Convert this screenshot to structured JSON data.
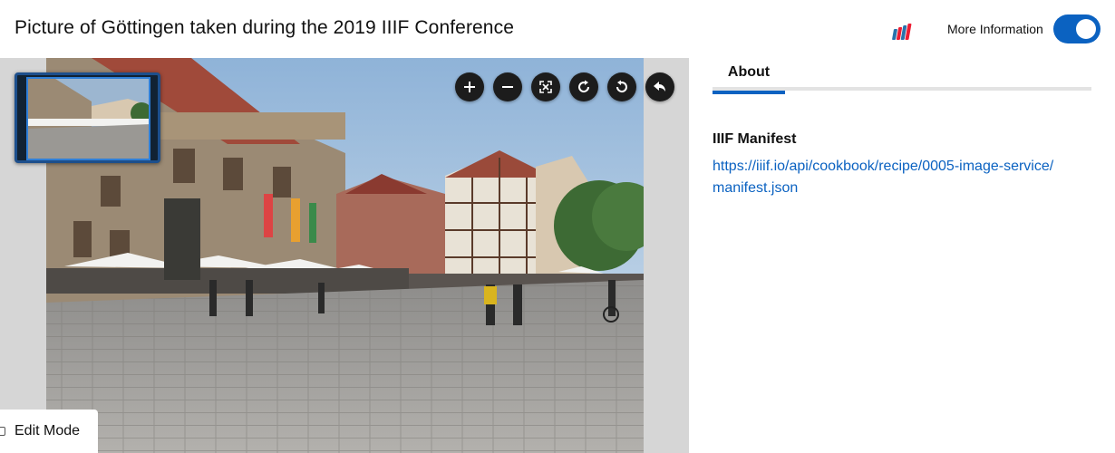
{
  "header": {
    "title": "Picture of Göttingen taken during the 2019 IIIF Conference",
    "logo_icon": "iiif-logo-icon",
    "more_info_label": "More Information",
    "more_info_toggle_on": true,
    "accent_color": "#0b62c1"
  },
  "viewer": {
    "controls": [
      {
        "name": "zoom-in",
        "icon": "plus-icon"
      },
      {
        "name": "zoom-out",
        "icon": "minus-icon"
      },
      {
        "name": "full-page",
        "icon": "fullscreen-icon"
      },
      {
        "name": "rotate-right",
        "icon": "rotate-right-icon"
      },
      {
        "name": "rotate-left",
        "icon": "rotate-left-icon"
      },
      {
        "name": "home",
        "icon": "reset-arrow-icon"
      }
    ],
    "edit_mode_label": "Edit Mode",
    "edit_mode_checked": false
  },
  "panel": {
    "tabs": [
      {
        "label": "About",
        "active": true
      }
    ],
    "manifest_heading": "IIIF Manifest",
    "manifest_url": "https://iiif.io/api/cookbook/recipe/0005-image-service/manifest.json"
  }
}
